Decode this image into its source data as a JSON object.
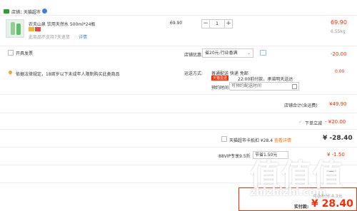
{
  "store": {
    "label": "店铺：",
    "name": "天猫超市"
  },
  "item": {
    "title": "农夫山泉 饮用天然水 500ml*24瓶",
    "note": "此商品不支持7天退货",
    "note_link": "详情",
    "unit_price": "69.90",
    "quantity": "1",
    "subtotal": "69.90",
    "weight": "6.55kg",
    "qty_minus": "−",
    "qty_plus": "+"
  },
  "invoice": {
    "label": "开具发票"
  },
  "shop_discount": {
    "label": "店铺优惠:",
    "select_value": "省20元:行业香满",
    "amount": "-20.00"
  },
  "notice": {
    "text": "依据法律规定，18周岁以下未成年人限制购买此类商品"
  },
  "delivery": {
    "label": "运送方式:",
    "line1": "普通配送 快递 免邮",
    "tag": "天猫直送",
    "line2": "22:00前付款，承诺明天送达",
    "time_label": "预约时间",
    "time_placeholder": "可预约配送时间",
    "amount": "0.00"
  },
  "store_total": {
    "label": "店铺合计(含运费)",
    "amount": "¥49.90"
  },
  "instant_discount": {
    "label": "下单立减",
    "amount": "- ¥20.00"
  },
  "card_deduct": {
    "label": "天猫超市卡抵扣 ¥28.4",
    "link": "查看详情",
    "amount": "¥ -28.40"
  },
  "vip": {
    "label": "88VIP专享9.5折",
    "value": "节省1.50元",
    "amount": "¥ -1.50"
  },
  "footer": {
    "paid_label": "实付款:",
    "paid_amount": "¥ 28.40",
    "points": "可获积分 4.3元",
    "watermark": "zhizhizhi.com",
    "watermark_cn": "值值值"
  },
  "colors": {
    "accent": "#ff2a00",
    "brand_green": "#2ca02c",
    "blue_badge": "#3a83d8"
  },
  "icons": {
    "store": "store-icon",
    "location": "location-pin-icon",
    "calendar": "calendar-icon",
    "message": "message-icon"
  }
}
